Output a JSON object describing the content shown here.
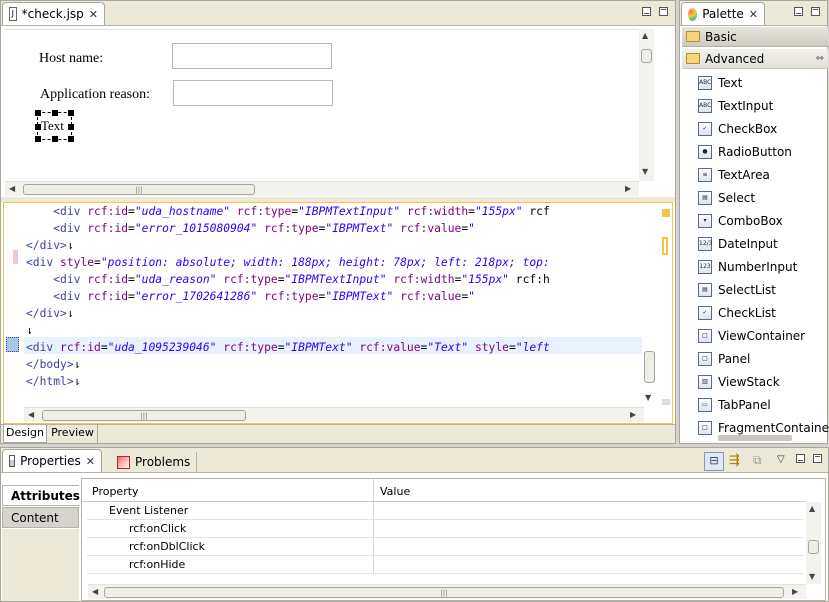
{
  "editor": {
    "tab_label": "*check.jsp",
    "tab_close": "✕",
    "design_form": {
      "host_label": "Host name:",
      "reason_label": "Application reason:",
      "text_widget": "Text"
    },
    "code_lines": [
      "    <div rcf:id=\"uda_hostname\" rcf:type=\"IBPMTextInput\" rcf:width=\"155px\" rcf",
      "    <div rcf:id=\"error_1015080904\" rcf:type=\"IBPMText\" rcf:value=\"",
      "</div>⇂",
      "<div style=\"position: absolute; width: 188px; height: 78px; left: 218px; top:",
      "    <div rcf:id=\"uda_reason\" rcf:type=\"IBPMTextInput\" rcf:width=\"155px\" rcf:h",
      "    <div rcf:id=\"error_1702641286\" rcf:type=\"IBPMText\" rcf:value=\"",
      "</div>⇂",
      "⇂",
      "<div rcf:id=\"uda_1095239046\" rcf:type=\"IBPMText\" rcf:value=\"Text\" style=\"left",
      "</body>⇂",
      "</html>⇂"
    ],
    "bottom_tabs": [
      "Design",
      "Preview"
    ]
  },
  "palette": {
    "title": "Palette",
    "close": "✕",
    "drawers": [
      "Basic",
      "Advanced"
    ],
    "items": [
      {
        "label": "Text",
        "icon": "text-icon",
        "glyph": "ABC"
      },
      {
        "label": "TextInput",
        "icon": "textinput-icon",
        "glyph": "ABC"
      },
      {
        "label": "CheckBox",
        "icon": "checkbox-icon",
        "glyph": "✓"
      },
      {
        "label": "RadioButton",
        "icon": "radiobutton-icon",
        "glyph": "●"
      },
      {
        "label": "TextArea",
        "icon": "textarea-icon",
        "glyph": "≡"
      },
      {
        "label": "Select",
        "icon": "select-icon",
        "glyph": "▤"
      },
      {
        "label": "ComboBox",
        "icon": "combobox-icon",
        "glyph": "▾"
      },
      {
        "label": "DateInput",
        "icon": "dateinput-icon",
        "glyph": "12/3"
      },
      {
        "label": "NumberInput",
        "icon": "numberinput-icon",
        "glyph": "123"
      },
      {
        "label": "SelectList",
        "icon": "selectlist-icon",
        "glyph": "▤"
      },
      {
        "label": "CheckList",
        "icon": "checklist-icon",
        "glyph": "✓"
      },
      {
        "label": "ViewContainer",
        "icon": "viewcontainer-icon",
        "glyph": "□"
      },
      {
        "label": "Panel",
        "icon": "panel-icon",
        "glyph": "□"
      },
      {
        "label": "ViewStack",
        "icon": "viewstack-icon",
        "glyph": "▥"
      },
      {
        "label": "TabPanel",
        "icon": "tabpanel-icon",
        "glyph": "▭"
      },
      {
        "label": "FragmentContainer",
        "icon": "fragmentcontainer-icon",
        "glyph": "□"
      }
    ]
  },
  "bottom": {
    "tabs": [
      {
        "label": "Properties",
        "close": "✕"
      },
      {
        "label": "Problems"
      }
    ],
    "side_tabs": [
      "Attributes",
      "Content"
    ],
    "columns": [
      "Property",
      "Value"
    ],
    "rows": [
      {
        "property": "Event Listener",
        "value": ""
      },
      {
        "property": "rcf:onClick",
        "value": ""
      },
      {
        "property": "rcf:onDblClick",
        "value": ""
      },
      {
        "property": "rcf:onHide",
        "value": ""
      }
    ]
  },
  "colors": {
    "selection_accent": "#f4c542",
    "tag": "#007a7a",
    "attribute": "#7f007f",
    "string": "#2a00ff"
  }
}
